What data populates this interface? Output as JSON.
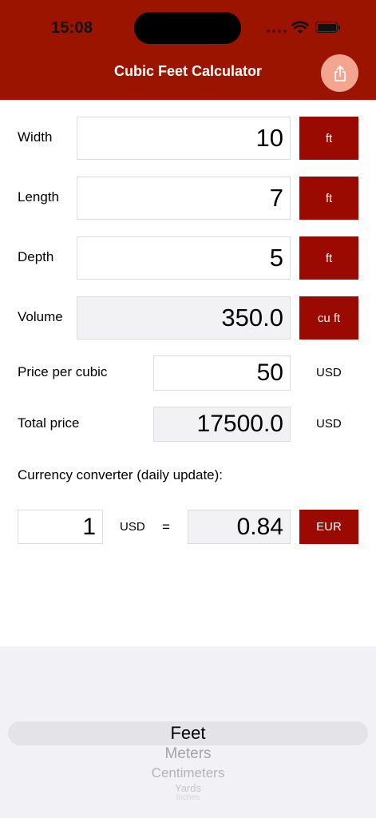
{
  "status_bar": {
    "time": "15:08"
  },
  "header": {
    "title": "Cubic Feet Calculator",
    "share_icon": "share-icon",
    "color": "#9b1400",
    "share_button_color": "#f4a58f"
  },
  "rows": {
    "width": {
      "label": "Width",
      "value": "10",
      "unit": "ft"
    },
    "length": {
      "label": "Length",
      "value": "7",
      "unit": "ft"
    },
    "depth": {
      "label": "Depth",
      "value": "5",
      "unit": "ft"
    },
    "volume": {
      "label": "Volume",
      "value": "350.0",
      "unit": "cu ft"
    }
  },
  "price": {
    "label": "Price per cubic",
    "value": "50",
    "currency": "USD"
  },
  "total": {
    "label": "Total price",
    "value": "17500.0",
    "currency": "USD"
  },
  "converter": {
    "heading": "Currency converter (daily update):",
    "amount": "1",
    "from_currency": "USD",
    "equals": "=",
    "result": "0.84",
    "to_currency": "EUR"
  },
  "picker": {
    "options": [
      "Feet",
      "Meters",
      "Centimeters",
      "Yards",
      "Inches"
    ],
    "selected": "Feet"
  },
  "colors": {
    "accent": "#9b0a00",
    "readonly_bg": "#f2f2f4"
  }
}
